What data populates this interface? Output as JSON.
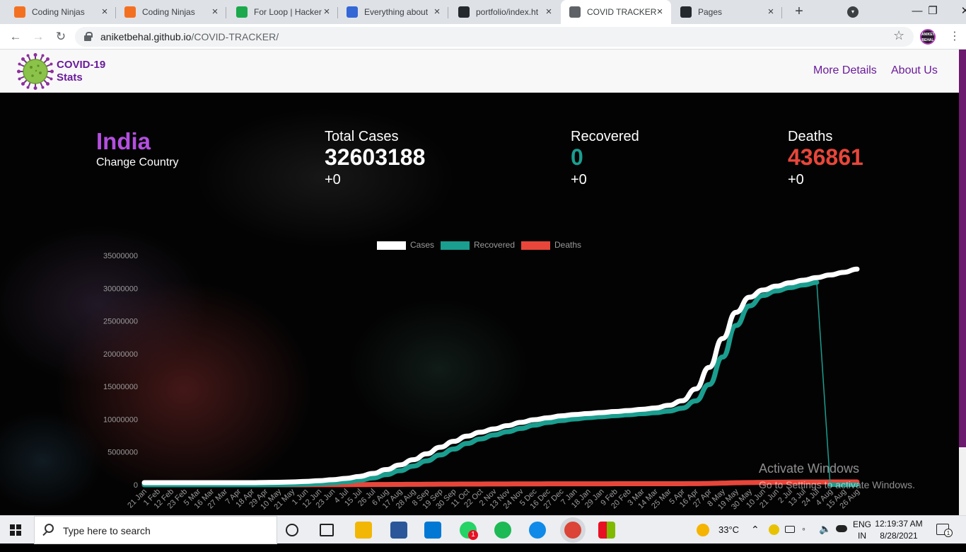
{
  "browser": {
    "tabs": [
      {
        "title": "Coding Ninjas",
        "icon": "coding-ninjas-icon",
        "color": "#f37021"
      },
      {
        "title": "Coding Ninjas",
        "icon": "coding-ninjas-icon",
        "color": "#f37021"
      },
      {
        "title": "For Loop | Hacker",
        "icon": "hackerrank-icon",
        "color": "#1ba94c"
      },
      {
        "title": "Everything about",
        "icon": "site-icon",
        "color": "#3367d6"
      },
      {
        "title": "portfolio/index.ht",
        "icon": "github-icon",
        "color": "#24292e"
      },
      {
        "title": "COVID TRACKER",
        "icon": "globe-icon",
        "color": "#5f6368",
        "active": true
      },
      {
        "title": "Pages",
        "icon": "github-icon",
        "color": "#24292e"
      }
    ],
    "url_host": "aniketbehal.github.io",
    "url_path": "/COVID-TRACKER/",
    "profile_text": "ANIKET BEHAL"
  },
  "navbar": {
    "brand_line1": "COVID-19",
    "brand_line2": "Stats",
    "links": [
      "More Details",
      "About Us"
    ]
  },
  "stats": {
    "country": "India",
    "change_country": "Change Country",
    "total": {
      "label": "Total Cases",
      "value": "32603188",
      "delta": "+0",
      "color": "#ffffff"
    },
    "recovered": {
      "label": "Recovered",
      "value": "0",
      "delta": "+0",
      "color": "#1a9e8f"
    },
    "deaths": {
      "label": "Deaths",
      "value": "436861",
      "delta": "+0",
      "color": "#e8463a"
    }
  },
  "chart_data": {
    "type": "line",
    "legend_position": "top-center",
    "y_ticks": [
      "35000000",
      "30000000",
      "25000000",
      "20000000",
      "15000000",
      "10000000",
      "5000000",
      "0"
    ],
    "ylim": [
      0,
      35000000
    ],
    "x": [
      "21 Jan",
      "1 Feb",
      "12 Feb",
      "23 Feb",
      "5 Mar",
      "16 Mar",
      "27 Mar",
      "7 Apr",
      "18 Apr",
      "29 Apr",
      "10 May",
      "21 May",
      "1 Jun",
      "12 Jun",
      "23 Jun",
      "4 Jul",
      "15 Jul",
      "26 Jul",
      "6 Aug",
      "17 Aug",
      "28 Aug",
      "8 Sep",
      "19 Sep",
      "30 Sep",
      "11 Oct",
      "22 Oct",
      "2 Nov",
      "13 Nov",
      "24 Nov",
      "5 Dec",
      "16 Dec",
      "27 Dec",
      "7 Jan",
      "18 Jan",
      "29 Jan",
      "9 Feb",
      "20 Feb",
      "3 Mar",
      "14 Mar",
      "25 Mar",
      "5 Apr",
      "16 Apr",
      "27 Apr",
      "8 May",
      "19 May",
      "30 May",
      "10 Jun",
      "21 Jun",
      "2 Jul",
      "13 Jul",
      "24 Jul",
      "4 Aug",
      "15 Aug",
      "26 Aug"
    ],
    "series": [
      {
        "name": "Cases",
        "color": "#ffffff",
        "values": [
          0,
          0,
          0,
          0,
          0,
          0,
          0,
          0,
          0,
          30000,
          60000,
          110000,
          190000,
          300000,
          440000,
          650000,
          950000,
          1400000,
          2000000,
          2700000,
          3500000,
          4400000,
          5400000,
          6300000,
          7100000,
          7700000,
          8200000,
          8700000,
          9200000,
          9600000,
          9900000,
          10200000,
          10400000,
          10550000,
          10700000,
          10850000,
          11000000,
          11200000,
          11400000,
          11800000,
          12500000,
          14300000,
          17600000,
          22000000,
          26000000,
          28300000,
          29400000,
          30000000,
          30500000,
          30900000,
          31300000,
          31700000,
          32100000,
          32600000
        ]
      },
      {
        "name": "Recovered",
        "color": "#1a9e8f",
        "values": [
          0,
          0,
          0,
          0,
          0,
          0,
          0,
          0,
          0,
          10000,
          30000,
          60000,
          110000,
          190000,
          300000,
          460000,
          700000,
          1050000,
          1550000,
          2150000,
          2850000,
          3650000,
          4550000,
          5450000,
          6300000,
          7000000,
          7600000,
          8100000,
          8600000,
          9100000,
          9500000,
          9800000,
          10050000,
          10250000,
          10400000,
          10550000,
          10700000,
          10850000,
          11000000,
          11250000,
          11700000,
          12800000,
          15300000,
          19500000,
          24300000,
          27300000,
          28900000,
          29600000,
          30100000,
          30500000,
          30900000,
          0,
          0,
          0
        ]
      },
      {
        "name": "Deaths",
        "color": "#e8463a",
        "values": [
          0,
          0,
          0,
          0,
          0,
          0,
          0,
          0,
          0,
          1000,
          2000,
          3500,
          5500,
          9000,
          14000,
          20000,
          28000,
          36000,
          46000,
          56000,
          66000,
          76000,
          88000,
          98000,
          106000,
          114000,
          121000,
          127000,
          133000,
          138000,
          143000,
          147000,
          150000,
          152000,
          154000,
          156000,
          157000,
          159000,
          160000,
          162000,
          166000,
          175000,
          200000,
          250000,
          310000,
          340000,
          370000,
          390000,
          405000,
          412000,
          420000,
          426000,
          431000,
          436861
        ]
      }
    ]
  },
  "watermark": {
    "line1": "Activate Windows",
    "line2": "Go to Settings to activate Windows."
  },
  "taskbar": {
    "search_placeholder": "Type here to search",
    "whatsapp_badge": "1",
    "weather": "33°C",
    "lang1": "ENG",
    "lang2": "IN",
    "time": "12:19:37 AM",
    "date": "8/28/2021",
    "notification_count": "1"
  }
}
